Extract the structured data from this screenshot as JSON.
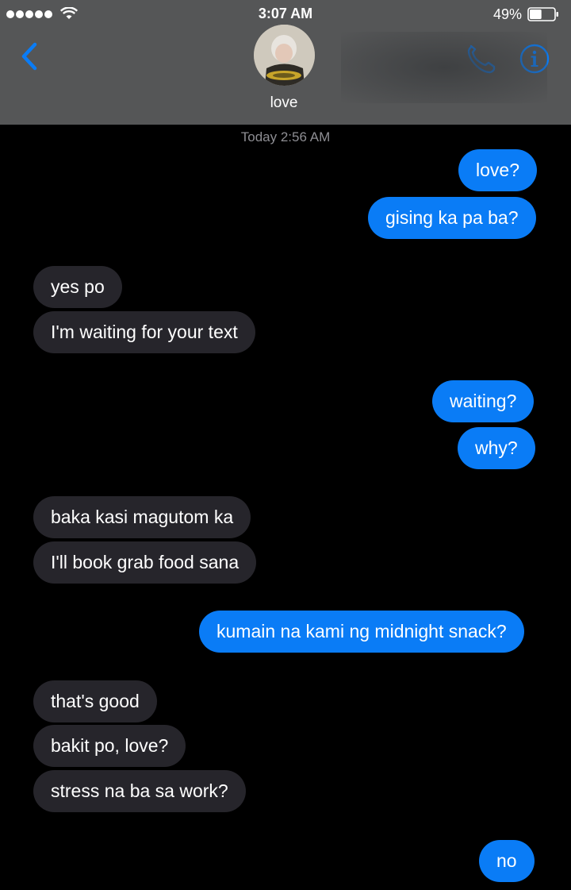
{
  "status_bar": {
    "signal_bars": 5,
    "time": "3:07 AM",
    "battery_percent": "49%",
    "battery_level": 0.49
  },
  "header": {
    "contact_name": "love",
    "back_icon": "chevron-left-icon",
    "call_icon": "phone-icon",
    "info_icon": "info-icon",
    "accent_color": "#0a7cf6",
    "background_color": "#555657"
  },
  "chat": {
    "timestamp": "Today 2:56 AM",
    "outgoing_color": "#0a7cf6",
    "incoming_color": "#26252b",
    "messages": [
      {
        "from": "me",
        "text": "love?"
      },
      {
        "from": "me",
        "text": "gising ka pa ba?"
      },
      {
        "from": "them",
        "text": "yes po"
      },
      {
        "from": "them",
        "text": "I'm waiting for your text"
      },
      {
        "from": "me",
        "text": "waiting?"
      },
      {
        "from": "me",
        "text": "why?"
      },
      {
        "from": "them",
        "text": "baka kasi magutom ka"
      },
      {
        "from": "them",
        "text": "I'll book grab food sana"
      },
      {
        "from": "me",
        "text": "kumain na kami ng midnight snack?"
      },
      {
        "from": "them",
        "text": "that's good"
      },
      {
        "from": "them",
        "text": "bakit po, love?"
      },
      {
        "from": "them",
        "text": "stress na ba sa work?"
      },
      {
        "from": "me",
        "text": "no"
      }
    ]
  }
}
